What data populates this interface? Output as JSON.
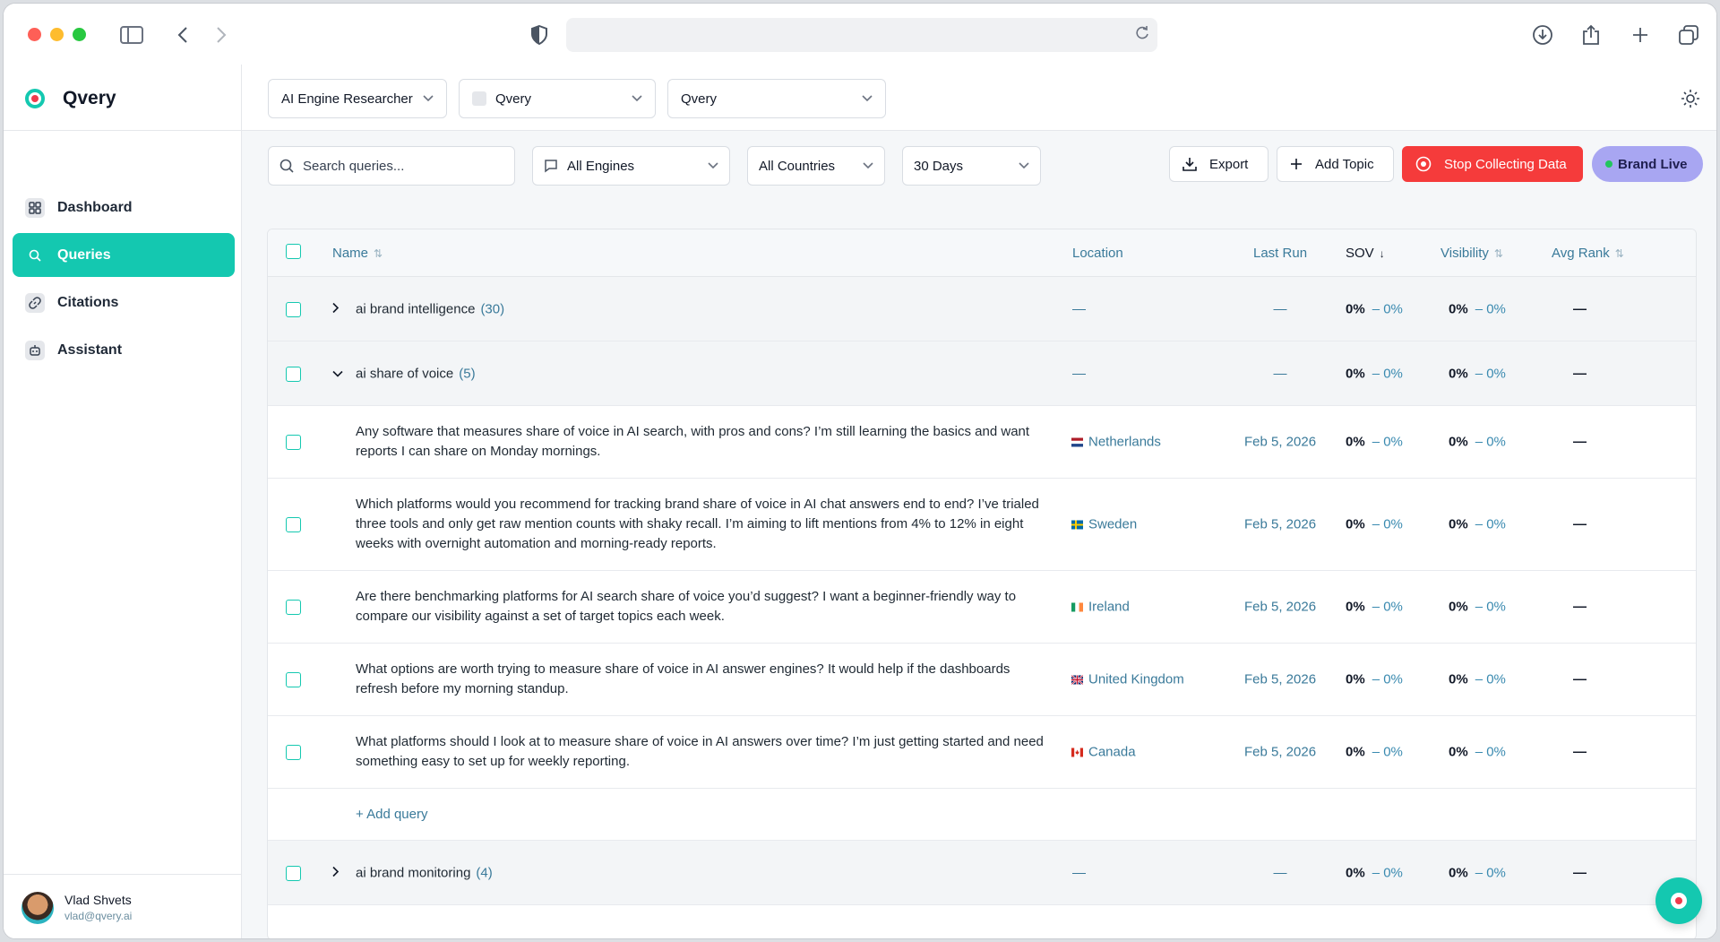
{
  "app": {
    "name": "Qvery"
  },
  "sidebar": {
    "items": [
      {
        "label": "Dashboard",
        "icon": "dashboard-icon",
        "active": false
      },
      {
        "label": "Queries",
        "icon": "search-icon",
        "active": true
      },
      {
        "label": "Citations",
        "icon": "link-icon",
        "active": false
      },
      {
        "label": "Assistant",
        "icon": "bot-icon",
        "active": false
      }
    ],
    "user": {
      "name": "Vlad Shvets",
      "email": "vlad@qvery.ai"
    }
  },
  "topbar": {
    "role_select": "AI Engine Researcher",
    "workspace_select": "Qvery",
    "brand_select": "Qvery"
  },
  "filters": {
    "search_placeholder": "Search queries...",
    "engines": "All Engines",
    "countries": "All Countries",
    "range": "30 Days",
    "export": "Export",
    "add_topic": "Add Topic",
    "stop": "Stop Collecting Data",
    "live": "Brand Live"
  },
  "table": {
    "headers": {
      "name": "Name",
      "location": "Location",
      "last_run": "Last Run",
      "sov": "SOV",
      "visibility": "Visibility",
      "avg_rank": "Avg Rank"
    },
    "groups": [
      {
        "name": "ai brand intelligence",
        "count": "(30)",
        "location": "—",
        "last_run": "—",
        "sov": "0%",
        "sov_delta": "– 0%",
        "vis": "0%",
        "vis_delta": "– 0%",
        "rank": "—"
      },
      {
        "name": "ai share of voice",
        "count": "(5)",
        "location": "—",
        "last_run": "—",
        "sov": "0%",
        "sov_delta": "– 0%",
        "vis": "0%",
        "vis_delta": "– 0%",
        "rank": "—"
      },
      {
        "name": "ai brand monitoring",
        "count": "(4)",
        "location": "—",
        "last_run": "—",
        "sov": "0%",
        "sov_delta": "– 0%",
        "vis": "0%",
        "vis_delta": "– 0%",
        "rank": "—"
      }
    ],
    "queries": [
      {
        "text": "Any software that measures share of voice in AI search, with pros and cons? I’m still learning the basics and want reports I can share on Monday mornings.",
        "location": "Netherlands",
        "last_run": "Feb 5, 2026",
        "sov": "0%",
        "sov_delta": "– 0%",
        "vis": "0%",
        "vis_delta": "– 0%",
        "rank": "—"
      },
      {
        "text": "Which platforms would you recommend for tracking brand share of voice in AI chat answers end to end? I’ve trialed three tools and only get raw mention counts with shaky recall. I’m aiming to lift mentions from 4% to 12% in eight weeks with overnight automation and morning-ready reports.",
        "location": "Sweden",
        "last_run": "Feb 5, 2026",
        "sov": "0%",
        "sov_delta": "– 0%",
        "vis": "0%",
        "vis_delta": "– 0%",
        "rank": "—"
      },
      {
        "text": "Are there benchmarking platforms for AI search share of voice you’d suggest? I want a beginner-friendly way to compare our visibility against a set of target topics each week.",
        "location": "Ireland",
        "last_run": "Feb 5, 2026",
        "sov": "0%",
        "sov_delta": "– 0%",
        "vis": "0%",
        "vis_delta": "– 0%",
        "rank": "—"
      },
      {
        "text": "What options are worth trying to measure share of voice in AI answer engines? It would help if the dashboards refresh before my morning standup.",
        "location": "United Kingdom",
        "last_run": "Feb 5, 2026",
        "sov": "0%",
        "sov_delta": "– 0%",
        "vis": "0%",
        "vis_delta": "– 0%",
        "rank": "—"
      },
      {
        "text": "What platforms should I look at to measure share of voice in AI answers over time? I’m just getting started and need something easy to set up for weekly reporting.",
        "location": "Canada",
        "last_run": "Feb 5, 2026",
        "sov": "0%",
        "sov_delta": "– 0%",
        "vis": "0%",
        "vis_delta": "– 0%",
        "rank": "—"
      }
    ],
    "add_query": "+ Add query"
  },
  "colors": {
    "accent": "#14c8b0",
    "danger": "#f53b3b",
    "live": "#a8a6f2",
    "link": "#3a7a9a"
  }
}
